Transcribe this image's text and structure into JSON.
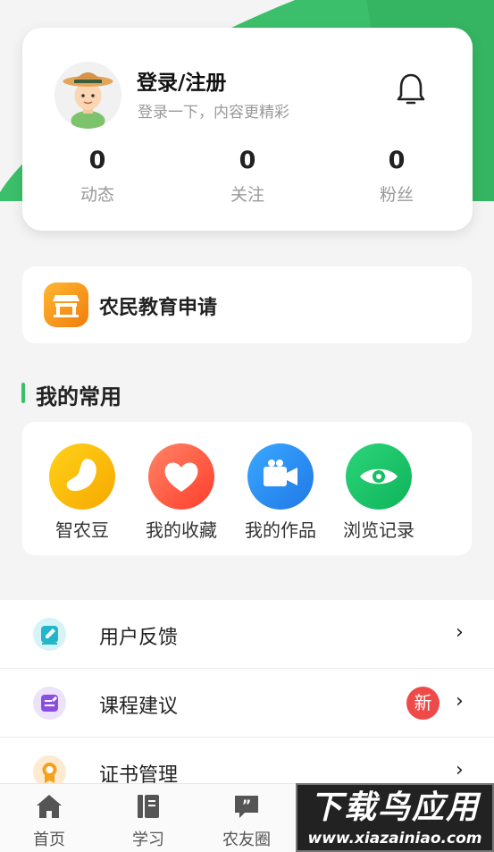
{
  "profile": {
    "title": "登录/注册",
    "subtitle": "登录一下，内容更精彩",
    "stats": [
      {
        "value": "0",
        "label": "动态"
      },
      {
        "value": "0",
        "label": "关注"
      },
      {
        "value": "0",
        "label": "粉丝"
      }
    ]
  },
  "education": {
    "label": "农民教育申请"
  },
  "common": {
    "title": "我的常用",
    "items": [
      {
        "label": "智农豆",
        "icon": "bean-icon",
        "color": "#ffbf10"
      },
      {
        "label": "我的收藏",
        "icon": "heart-icon",
        "color": "#ff6a4a"
      },
      {
        "label": "我的作品",
        "icon": "video-camera-icon",
        "color": "#2e8ff0"
      },
      {
        "label": "浏览记录",
        "icon": "eye-icon",
        "color": "#1fc86a"
      }
    ]
  },
  "menu": {
    "items": [
      {
        "label": "用户反馈",
        "chevron": "›",
        "icon": "edit-icon",
        "color": "#22b7c8"
      },
      {
        "label": "课程建议",
        "chevron": "›",
        "badge": "新",
        "icon": "note-icon",
        "color": "#8b4fe0"
      },
      {
        "label": "证书管理",
        "chevron": "›",
        "icon": "medal-icon",
        "color": "#f5a11a"
      }
    ]
  },
  "tabbar": {
    "items": [
      {
        "label": "首页",
        "icon": "home-icon"
      },
      {
        "label": "学习",
        "icon": "book-icon"
      },
      {
        "label": "农友圈",
        "icon": "chat-quote-icon"
      }
    ]
  },
  "watermark": {
    "title": "下载鸟应用",
    "url": "www.xiazainiao.com"
  },
  "colors": {
    "brand_green": "#3cbf6a",
    "badge_red": "#ee4a4a"
  }
}
